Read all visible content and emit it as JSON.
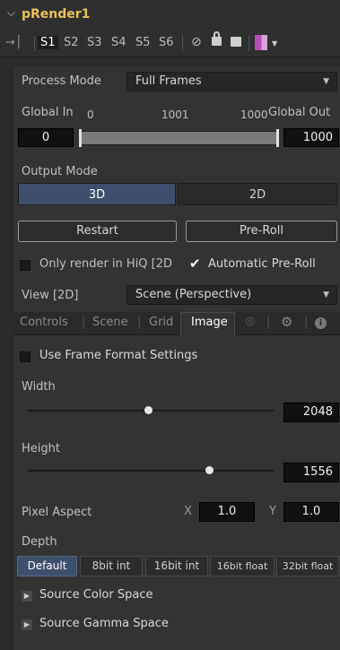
{
  "node": {
    "name": "pRender1"
  },
  "toolbar": {
    "slots": [
      "S1",
      "S2",
      "S3",
      "S4",
      "S5",
      "S6"
    ],
    "selected_slot": "S1"
  },
  "process_mode": {
    "label": "Process Mode",
    "value": "Full Frames"
  },
  "global_range": {
    "in_label": "Global In",
    "out_label": "Global Out",
    "start": "0",
    "mid": "1001",
    "end": "1000",
    "in_value": "0",
    "out_value": "1000"
  },
  "output_mode": {
    "label": "Output Mode",
    "options": [
      "3D",
      "2D"
    ],
    "selected": "3D"
  },
  "buttons": {
    "restart": "Restart",
    "preroll": "Pre-Roll"
  },
  "checks": {
    "hiq": {
      "label": "Only render in HiQ [2D",
      "checked": false
    },
    "auto_preroll": {
      "label": "Automatic Pre-Roll",
      "checked": true
    }
  },
  "view": {
    "label": "View [2D]",
    "value": "Scene (Perspective)"
  },
  "tabs": [
    "Controls",
    "Scene",
    "Grid",
    "Image"
  ],
  "active_tab": "Image",
  "image": {
    "use_frame_format": {
      "label": "Use Frame Format Settings",
      "checked": false
    },
    "width": {
      "label": "Width",
      "value": "2048",
      "fraction": 0.49
    },
    "height": {
      "label": "Height",
      "value": "1556",
      "fraction": 0.74
    },
    "pixel_aspect": {
      "label": "Pixel Aspect",
      "x_label": "X",
      "x": "1.0",
      "y_label": "Y",
      "y": "1.0"
    },
    "depth": {
      "label": "Depth",
      "options": [
        "Default",
        "8bit int",
        "16bit int",
        "16bit float",
        "32bit float"
      ],
      "selected": "Default"
    },
    "source_color_space": "Source Color Space",
    "source_gamma_space": "Source Gamma Space"
  },
  "colors": {
    "title": "#e8c25a",
    "active_segment": "#3d4f6b"
  }
}
